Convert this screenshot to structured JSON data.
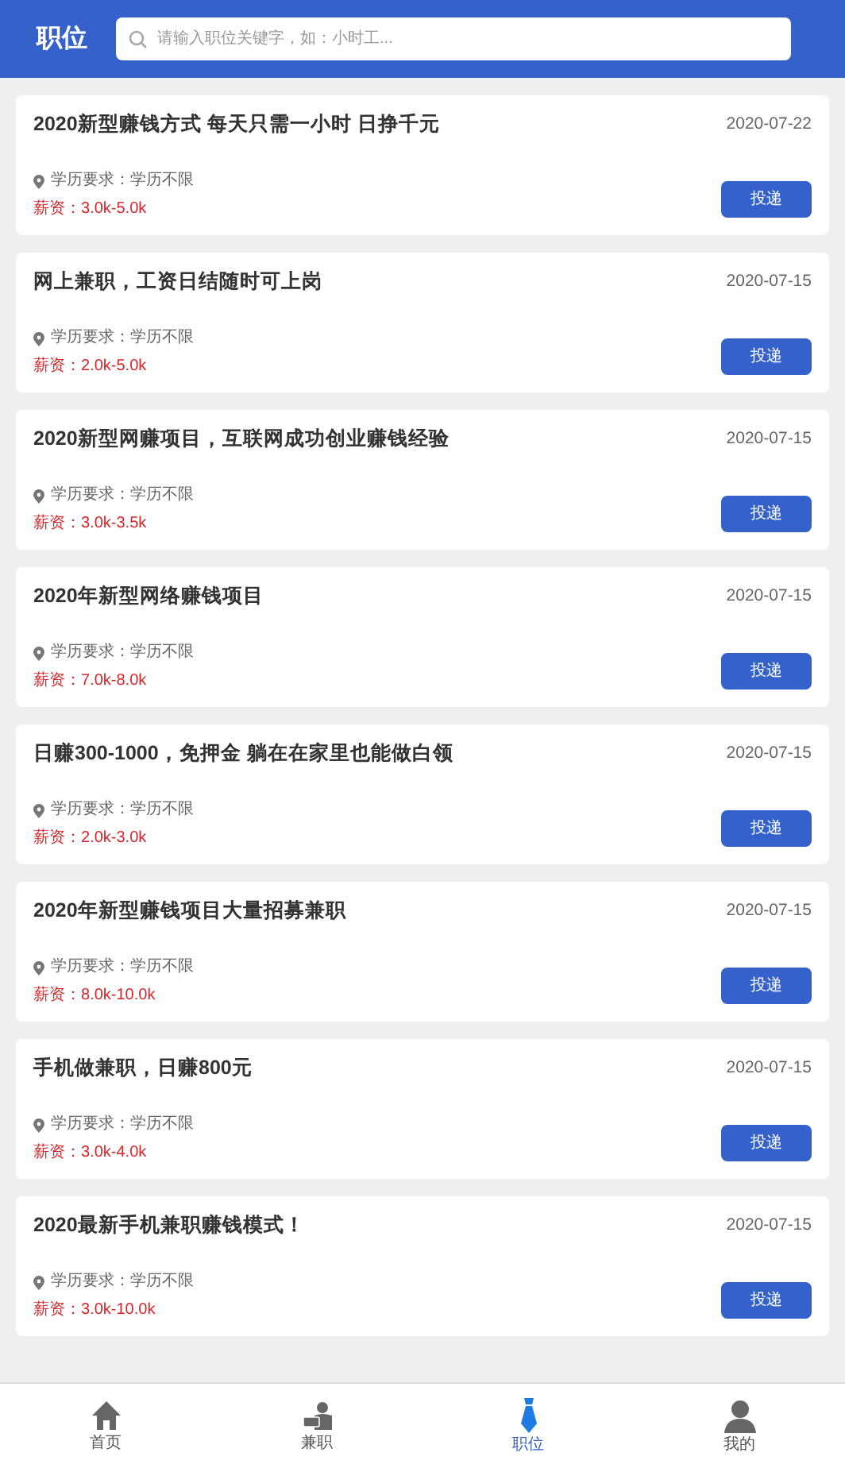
{
  "header": {
    "title": "职位",
    "search": {
      "placeholder": "请输入职位关键字，如：小时工..."
    }
  },
  "jobs": [
    {
      "title": "2020新型赚钱方式 每天只需一小时 日挣千元",
      "date": "2020-07-22",
      "education": "学历要求：学历不限",
      "salary": "薪资：3.0k-5.0k",
      "button": "投递"
    },
    {
      "title": "网上兼职，工资日结随时可上岗",
      "date": "2020-07-15",
      "education": "学历要求：学历不限",
      "salary": "薪资：2.0k-5.0k",
      "button": "投递"
    },
    {
      "title": "2020新型网赚项目，互联网成功创业赚钱经验",
      "date": "2020-07-15",
      "education": "学历要求：学历不限",
      "salary": "薪资：3.0k-3.5k",
      "button": "投递"
    },
    {
      "title": "2020年新型网络赚钱项目",
      "date": "2020-07-15",
      "education": "学历要求：学历不限",
      "salary": "薪资：7.0k-8.0k",
      "button": "投递"
    },
    {
      "title": "日赚300-1000，免押金 躺在在家里也能做白领",
      "date": "2020-07-15",
      "education": "学历要求：学历不限",
      "salary": "薪资：2.0k-3.0k",
      "button": "投递"
    },
    {
      "title": "2020年新型赚钱项目大量招募兼职",
      "date": "2020-07-15",
      "education": "学历要求：学历不限",
      "salary": "薪资：8.0k-10.0k",
      "button": "投递"
    },
    {
      "title": "手机做兼职，日赚800元",
      "date": "2020-07-15",
      "education": "学历要求：学历不限",
      "salary": "薪资：3.0k-4.0k",
      "button": "投递"
    },
    {
      "title": "2020最新手机兼职赚钱模式！",
      "date": "2020-07-15",
      "education": "学历要求：学历不限",
      "salary": "薪资：3.0k-10.0k",
      "button": "投递"
    }
  ],
  "tab_bar": [
    {
      "kind": "home",
      "label": "首页",
      "selected": false
    },
    {
      "kind": "parttime",
      "label": "兼职",
      "selected": false
    },
    {
      "kind": "jobs",
      "label": "职位",
      "selected": true
    },
    {
      "kind": "profile",
      "label": "我的",
      "selected": false
    }
  ]
}
